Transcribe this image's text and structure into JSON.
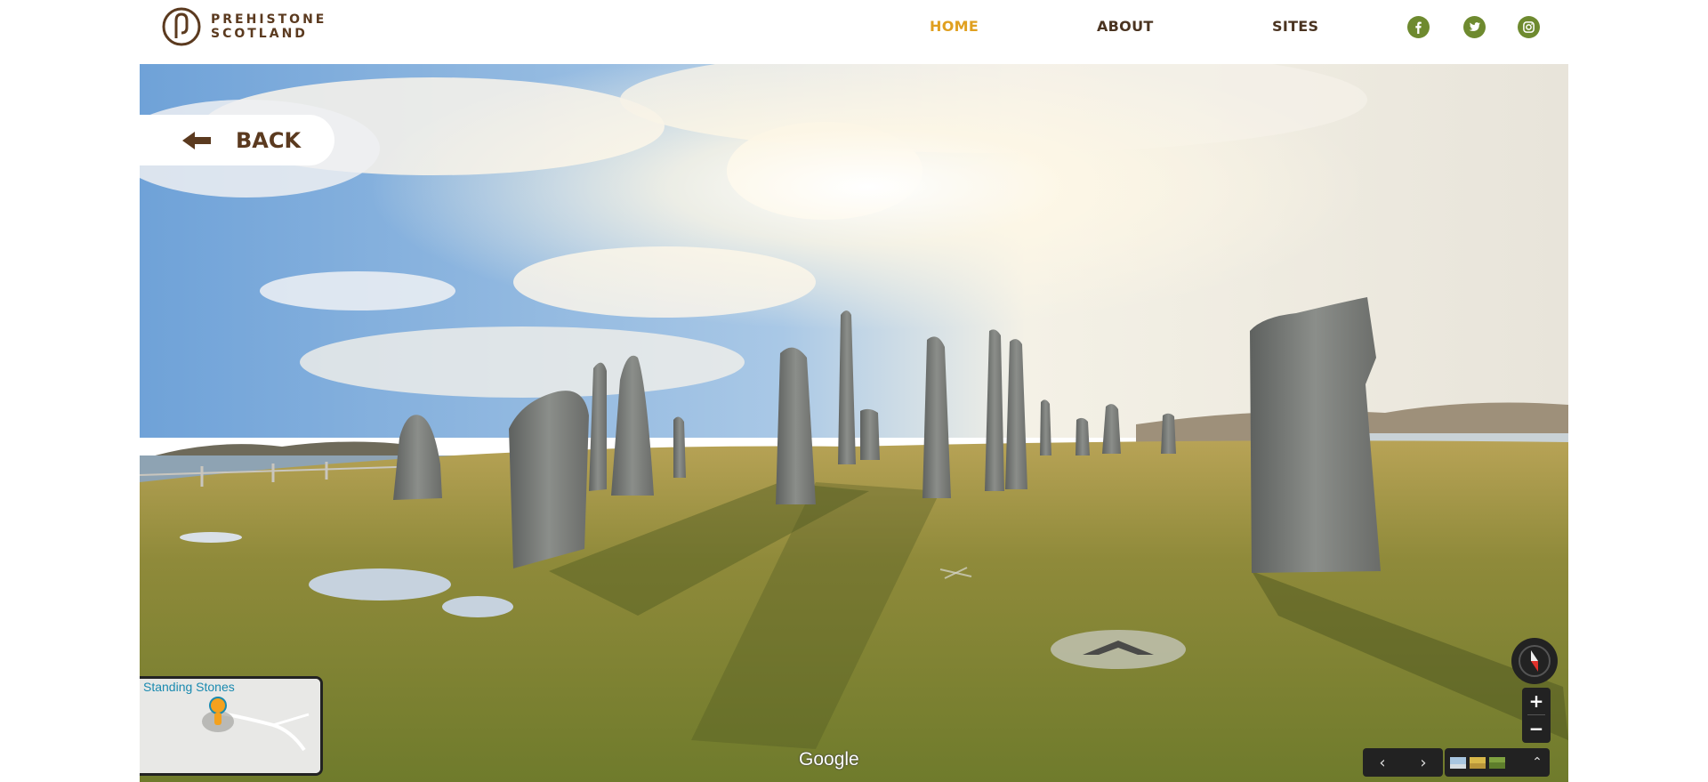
{
  "brand": {
    "name_line1": "PREHISTONE",
    "name_line2": "SCOTLAND",
    "color": "#5b3a1f"
  },
  "nav": {
    "items": [
      {
        "label": "HOME",
        "active": true
      },
      {
        "label": "ABOUT",
        "active": false
      },
      {
        "label": "SITES",
        "active": false
      }
    ],
    "active_color": "#e0a020",
    "social": [
      "facebook-icon",
      "twitter-icon",
      "instagram-icon"
    ],
    "social_color": "#6e8a2f"
  },
  "street_view": {
    "back_label": "BACK",
    "minimap_label": "Standing Stones",
    "provider": "Google",
    "zoom_in": "+",
    "zoom_out": "−",
    "prev": "‹",
    "next": "›",
    "expand": "⌃"
  }
}
